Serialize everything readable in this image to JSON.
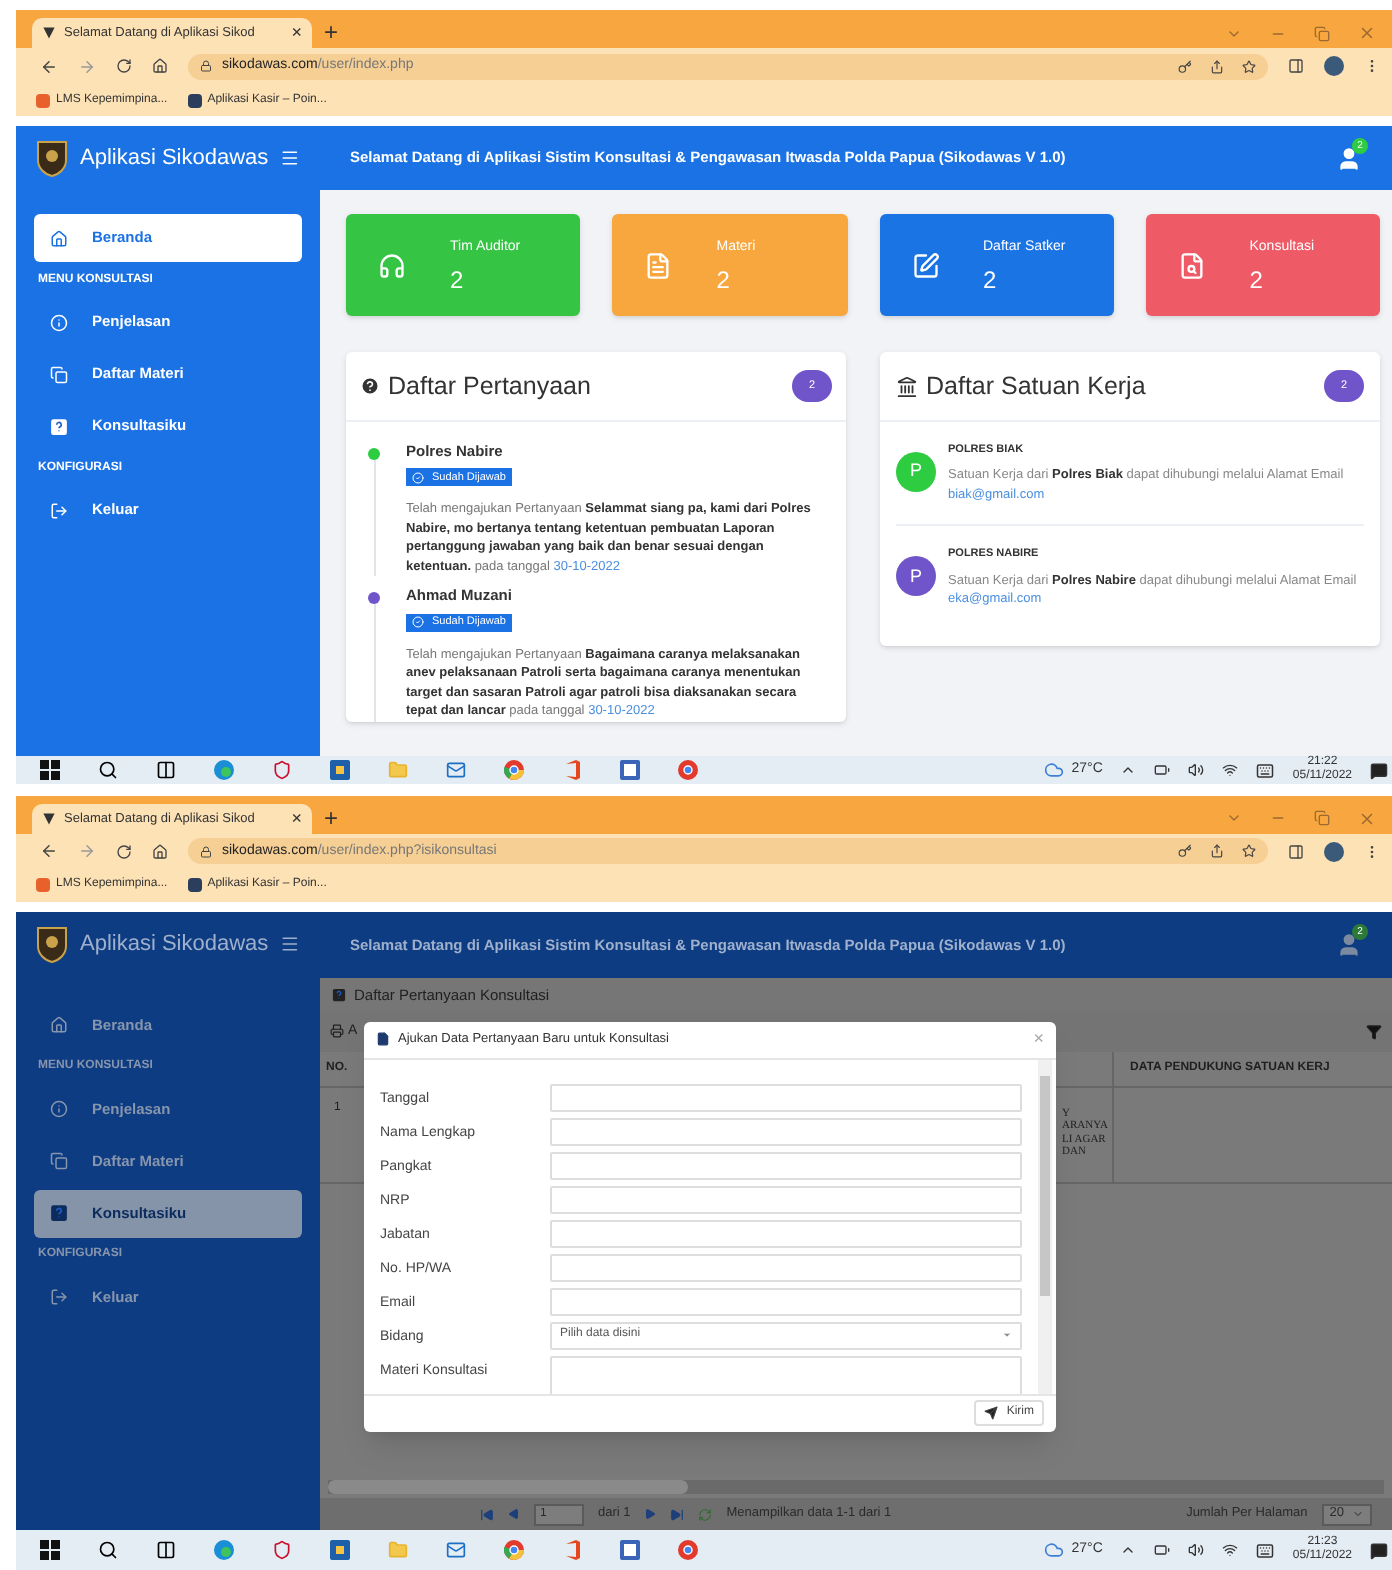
{
  "dashboard_capture": {
    "browser": {
      "tab_title": "Selamat Datang di Aplikasi Sikod",
      "tab_close": "×",
      "new_tab": "+",
      "url_host": "sikodawas.com",
      "url_path": "/user/index.php",
      "bookmarks": [
        "LMS Kepemimpina...",
        "Aplikasi Kasir – Poin..."
      ]
    },
    "header": {
      "app_name": "Aplikasi Sikodawas",
      "welcome": "Selamat Datang di Aplikasi Sistim Konsultasi & Pengawasan Itwasda Polda Papua (Sikodawas V 1.0)",
      "notification_count": "2"
    },
    "sidebar": [
      {
        "kind": "link",
        "label": "Beranda",
        "selected": true
      },
      {
        "kind": "section",
        "label": "MENU KONSULTASI"
      },
      {
        "kind": "link",
        "label": "Penjelasan",
        "selected": false
      },
      {
        "kind": "link",
        "label": "Daftar Materi",
        "selected": false
      },
      {
        "kind": "link",
        "label": "Konsultasiku",
        "selected": false
      },
      {
        "kind": "section",
        "label": "KONFIGURASI"
      },
      {
        "kind": "link",
        "label": "Keluar",
        "selected": false
      }
    ],
    "stat_cards": [
      {
        "label": "Tim Auditor",
        "value": "2",
        "color": "#35c443"
      },
      {
        "label": "Materi",
        "value": "2",
        "color": "#f8a73e"
      },
      {
        "label": "Daftar Satker",
        "value": "2",
        "color": "#1b74e4"
      },
      {
        "label": "Konsultasi",
        "value": "2",
        "color": "#ee5a66"
      }
    ],
    "questions": {
      "title": "Daftar Pertanyaan",
      "count": "2",
      "items": [
        {
          "name": "Polres Nabire",
          "status": "Sudah Dijawab",
          "text": "Telah mengajukan Pertanyaan **Selammat siang pa, kami dari Polres Nabire, mo bertanya tentang ketentuan pembuatan Laporan pertanggung jawaban yang baik dan benar sesuai dengan ketentuan.** pada tanggal",
          "date": "30-10-2022",
          "color": "#2ecc40"
        },
        {
          "name": "Ahmad Muzani",
          "status": "Sudah Dijawab",
          "text": "Telah mengajukan Pertanyaan **Bagaimana caranya melaksanakan anev pelaksanaan Patroli serta bagaimana caranya menentukan target dan sasaran Patroli agar patroli bisa diaksanakan secara tepat dan lancar** pada tanggal",
          "date": "30-10-2022",
          "color": "#6f55c9"
        }
      ]
    },
    "work_units": {
      "title": "Daftar Satuan Kerja",
      "count": "2",
      "items": [
        {
          "initial": "P",
          "name": "POLRES BIAK",
          "text": "Satuan Kerja dari **Polres Biak** dapat dihubungi melalui Alamat Email",
          "email": "biak@gmail.com",
          "color": "#2ecc40"
        },
        {
          "initial": "P",
          "name": "POLRES NABIRE",
          "text": "Satuan Kerja dari **Polres Nabire** dapat dihubungi melalui Alamat Email",
          "email": "eka@gmail.com",
          "color": "#6f55c9"
        }
      ]
    },
    "taskbar": {
      "weather": "27°C",
      "time": "21:22",
      "date": "05/11/2022"
    }
  },
  "consultation_capture": {
    "browser": {
      "tab_title": "Selamat Datang di Aplikasi Sikod",
      "tab_close": "×",
      "new_tab": "+",
      "url_host": "sikodawas.com",
      "url_path": "/user/index.php?isikonsultasi",
      "bookmarks": [
        "LMS Kepemimpina...",
        "Aplikasi Kasir – Poin..."
      ]
    },
    "header": {
      "app_name": "Aplikasi Sikodawas",
      "welcome": "Selamat Datang di Aplikasi Sistim Konsultasi & Pengawasan Itwasda Polda Papua (Sikodawas V 1.0)",
      "notification_count": "2"
    },
    "sidebar": [
      {
        "kind": "link",
        "label": "Beranda",
        "selected": false
      },
      {
        "kind": "section",
        "label": "MENU KONSULTASI"
      },
      {
        "kind": "link",
        "label": "Penjelasan",
        "selected": false
      },
      {
        "kind": "link",
        "label": "Daftar Materi",
        "selected": false
      },
      {
        "kind": "link",
        "label": "Konsultasiku",
        "selected": true
      },
      {
        "kind": "section",
        "label": "KONFIGURASI"
      },
      {
        "kind": "link",
        "label": "Keluar",
        "selected": false
      }
    ],
    "page": {
      "title": "Daftar Pertanyaan Konsultasi",
      "toolbar_button": "A",
      "table": {
        "columns": [
          "NO.",
          "DATA PENDUKUNG SATUAN KERJ"
        ],
        "rows": [
          {
            "no": "1",
            "visible_text": [
              "Y",
              "ARANYA",
              "LI AGAR",
              "DAN"
            ]
          }
        ]
      },
      "pagination": {
        "page": "1",
        "of": "dari 1",
        "summary": "Menampilkan data 1-1 dari 1",
        "per_page_label": "Jumlah Per Halaman",
        "per_page": "20"
      }
    },
    "modal": {
      "title": "Ajukan Data Pertanyaan Baru untuk Konsultasi",
      "close": "×",
      "fields": [
        {
          "label": "Tanggal",
          "kind": "text"
        },
        {
          "label": "Nama Lengkap",
          "kind": "text"
        },
        {
          "label": "Pangkat",
          "kind": "text"
        },
        {
          "label": "NRP",
          "kind": "text"
        },
        {
          "label": "Jabatan",
          "kind": "text"
        },
        {
          "label": "No. HP/WA",
          "kind": "text"
        },
        {
          "label": "Email",
          "kind": "text"
        },
        {
          "label": "Bidang",
          "kind": "select",
          "placeholder": "Pilih data disini"
        },
        {
          "label": "Materi Konsultasi",
          "kind": "textarea"
        }
      ],
      "submit": "Kirim"
    },
    "taskbar": {
      "weather": "27°C",
      "time": "21:23",
      "date": "05/11/2022"
    }
  }
}
